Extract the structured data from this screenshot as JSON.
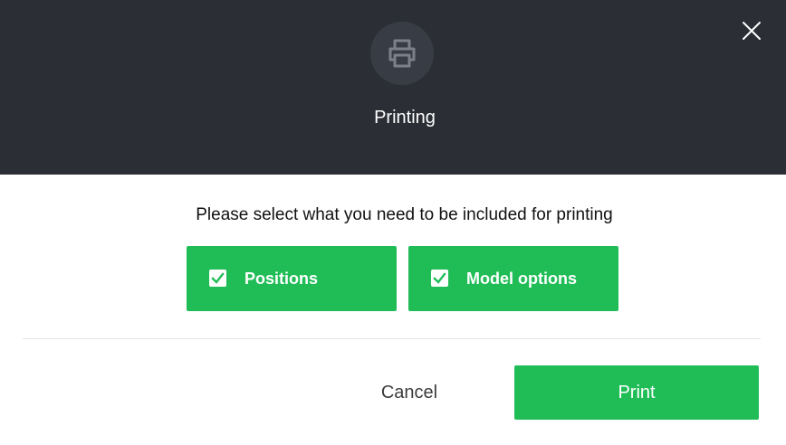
{
  "dialog": {
    "title": "Printing",
    "icon": "printer-icon",
    "close_icon": "close-icon"
  },
  "prompt": "Please select what you need to be included for printing",
  "options": [
    {
      "label": "Positions",
      "checked": true
    },
    {
      "label": "Model options",
      "checked": true
    }
  ],
  "actions": {
    "cancel_label": "Cancel",
    "print_label": "Print"
  },
  "colors": {
    "header_bg": "#2b2e35",
    "accent": "#20bd57"
  }
}
